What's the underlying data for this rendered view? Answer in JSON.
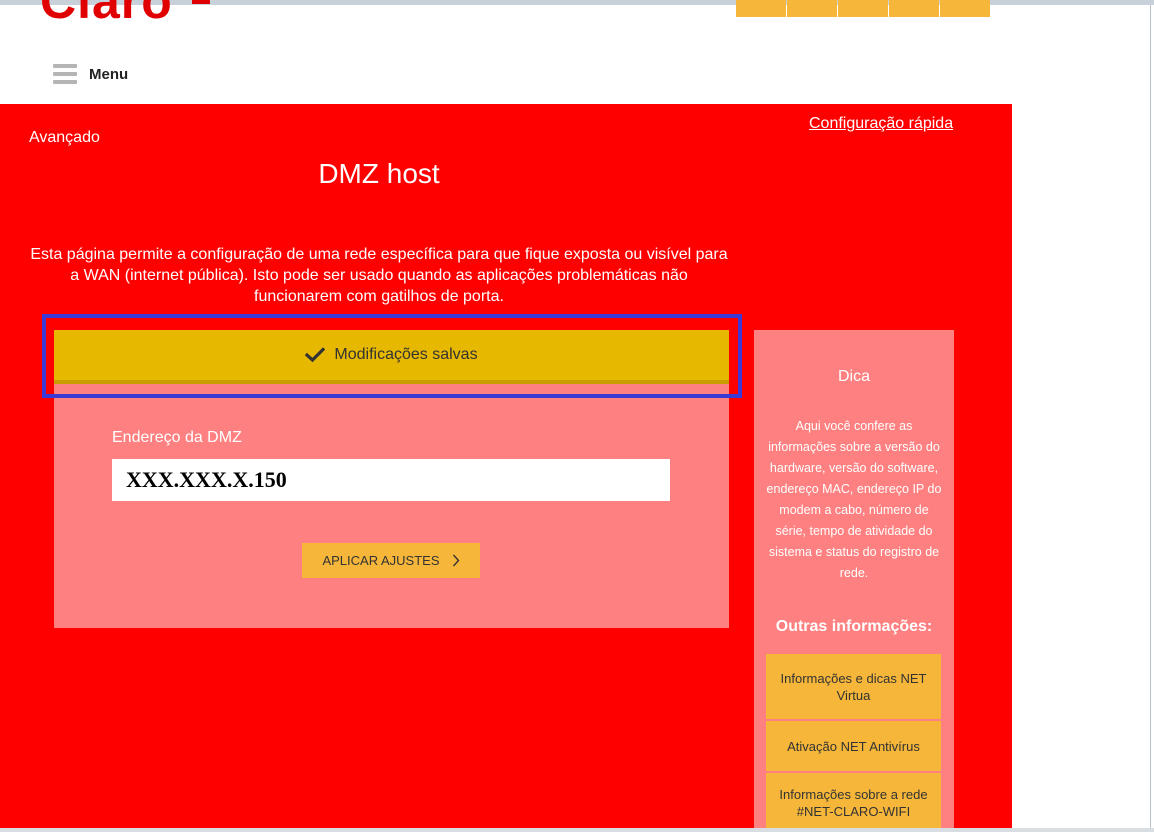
{
  "header": {
    "logo_text": "Claro",
    "menu_label": "Menu"
  },
  "breadcrumb": "Avançado",
  "quick_config_link": "Configuração rápida",
  "page": {
    "title": "DMZ host",
    "description": "Esta página permite a configuração de uma rede específica para que fique exposta ou visível para a WAN (internet pública). Isto pode ser usado quando as aplicações problemáticas não funcionarem com gatilhos de porta."
  },
  "status": {
    "message": "Modificações salvas"
  },
  "form": {
    "dmz_label": "Endereço da DMZ",
    "dmz_value": "XXX.XXX.X.150",
    "apply_label": "APLICAR AJUSTES"
  },
  "tip": {
    "title": "Dica",
    "text": "Aqui você confere as informações sobre a versão do hardware, versão do software, endereço MAC, endereço IP do modem a cabo, número de série, tempo de atividade do sistema e status do registro de rede.",
    "other_title": "Outras informações:",
    "links": [
      "Informações e dicas NET Virtua",
      "Ativação NET Antivírus",
      "Informações sobre a rede #NET-CLARO-WIFI"
    ]
  },
  "colors": {
    "brand_red": "#ff0000",
    "panel_pink": "#ff8080",
    "accent_yellow": "#f5b63a",
    "success_banner": "#e6b800",
    "highlight_border": "#3a3ad6"
  }
}
